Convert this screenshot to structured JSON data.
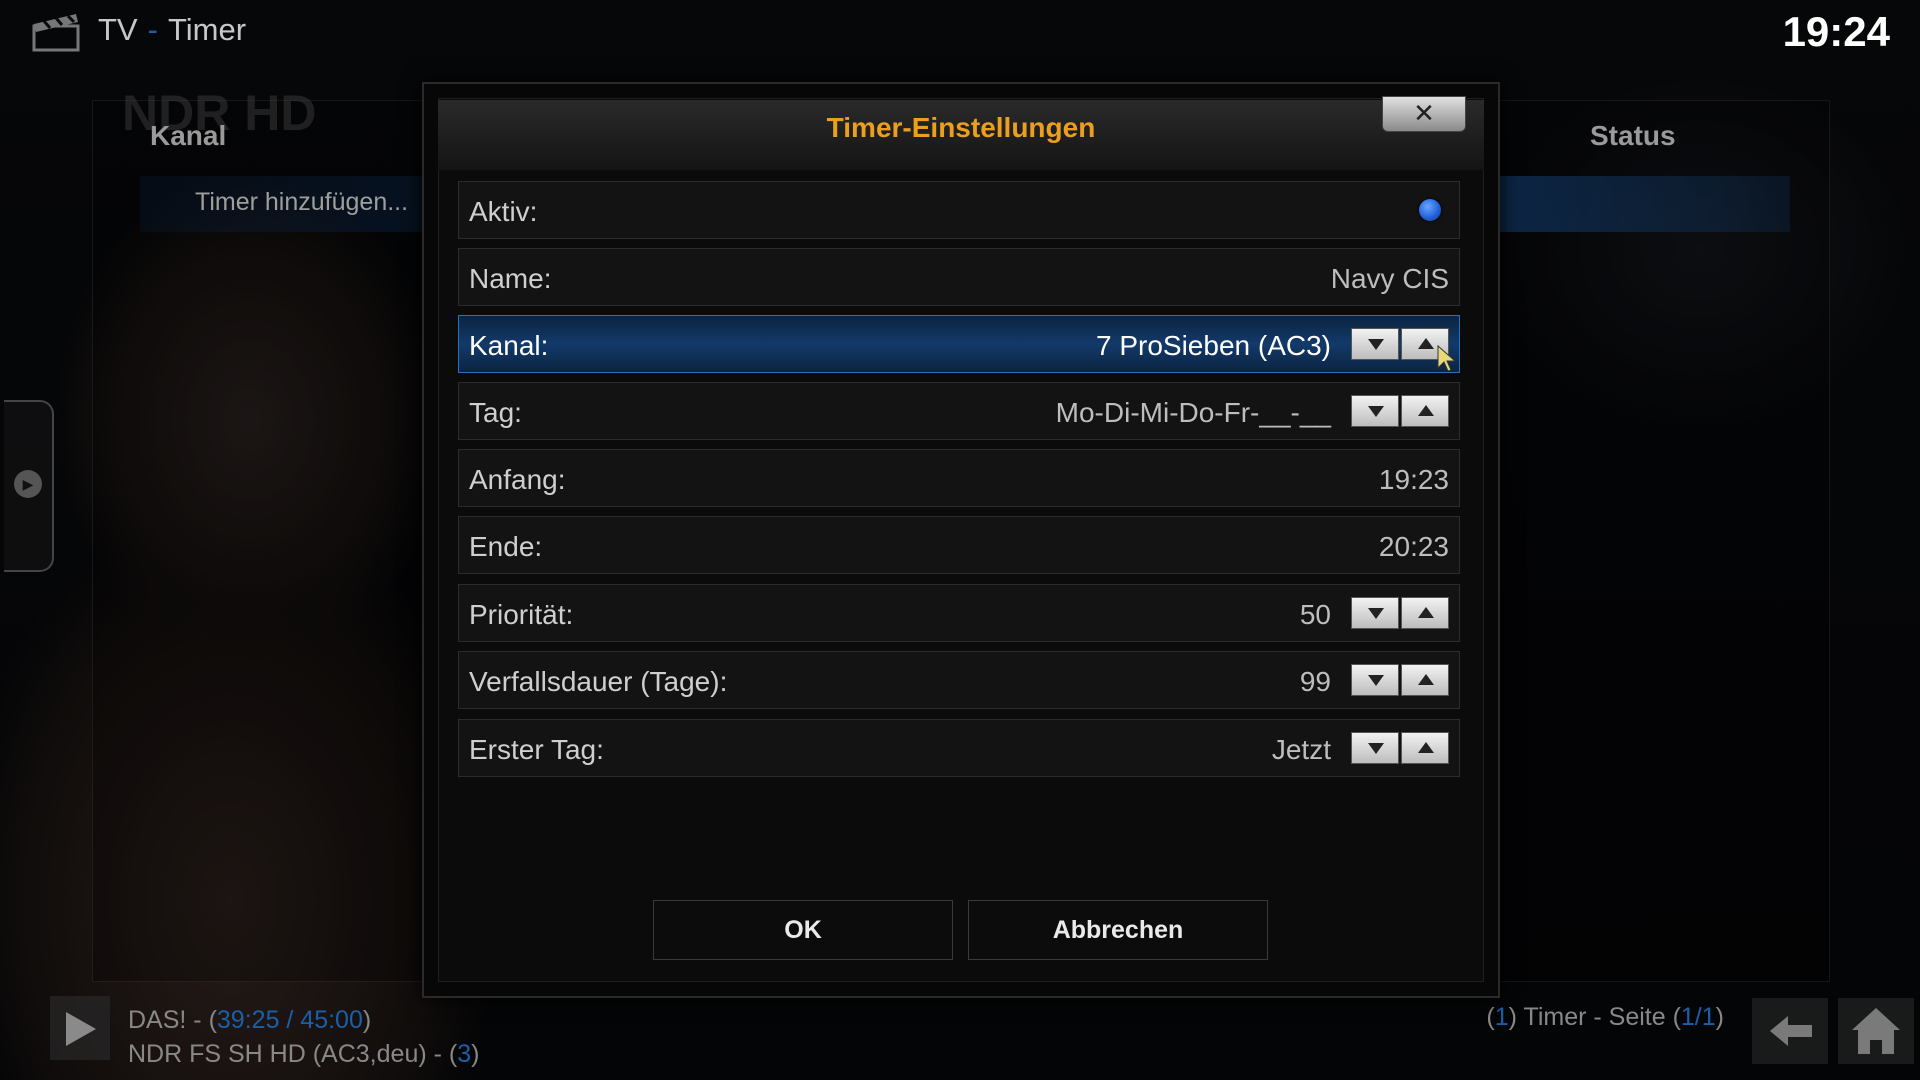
{
  "header": {
    "section": "TV",
    "separator": "-",
    "page": "Timer",
    "clock": "19:24"
  },
  "background": {
    "channel_logo": "NDR HD",
    "columns": {
      "kanal": "Kanal",
      "status": "Status"
    },
    "list_item": "Timer hinzufügen..."
  },
  "dialog": {
    "title": "Timer-Einstellungen",
    "close_symbol": "✕",
    "rows": [
      {
        "label": "Aktiv:",
        "type": "radio",
        "checked": true
      },
      {
        "label": "Name:",
        "value": "Navy CIS"
      },
      {
        "label": "Kanal:",
        "value": "7 ProSieben (AC3)",
        "spinner": true,
        "focused": true
      },
      {
        "label": "Tag:",
        "value": "Mo-Di-Mi-Do-Fr-__-__",
        "spinner": true
      },
      {
        "label": "Anfang:",
        "value": "19:23"
      },
      {
        "label": "Ende:",
        "value": "20:23"
      },
      {
        "label": "Priorität:",
        "value": "50",
        "spinner": true
      },
      {
        "label": "Verfallsdauer (Tage):",
        "value": "99",
        "spinner": true
      },
      {
        "label": "Erster Tag:",
        "value": "Jetzt",
        "spinner": true
      }
    ],
    "ok_label": "OK",
    "cancel_label": "Abbrechen"
  },
  "footer": {
    "now_title": "DAS! - (",
    "now_time": "39:25 / 45:00",
    "now_close": ")",
    "now_channel": "NDR FS SH HD (AC3,deu) - (",
    "now_channel_num": "3",
    "now_channel_close": ")",
    "page_open": "(",
    "page_count": "1",
    "page_text": ") Timer - Seite (",
    "page_num": "1/1",
    "page_close": ")"
  },
  "colors": {
    "accent_orange": "#eb9e1f",
    "accent_blue": "#1b5fa8",
    "radio_blue": "#1e5ed6"
  },
  "icons": [
    "clapperboard-icon",
    "close-icon",
    "chevron-down-icon",
    "chevron-up-icon",
    "play-icon",
    "back-arrow-icon",
    "home-icon",
    "radio-indicator-icon"
  ]
}
